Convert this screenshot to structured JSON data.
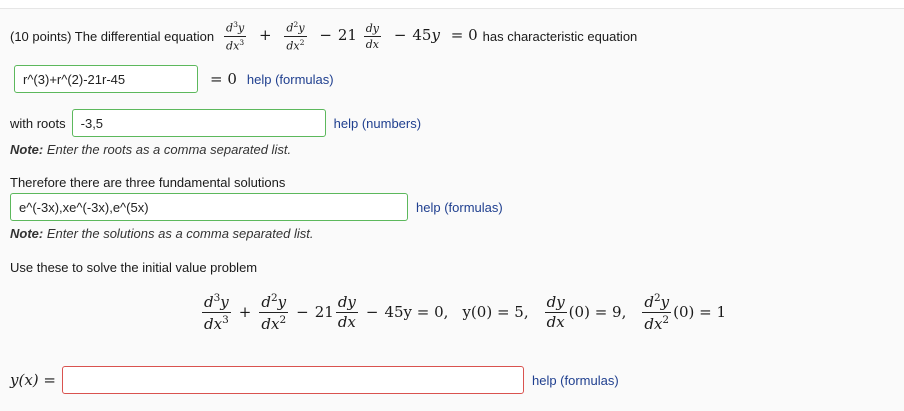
{
  "question": {
    "intro": "(10 points) The differential equation",
    "coef_21": "21",
    "coef_45": "45",
    "has_char": "has characteristic equation",
    "eq_zero": "= 0"
  },
  "char_eq": {
    "value": "r^(3)+r^(2)-21r-45",
    "help": "help (formulas)"
  },
  "roots": {
    "label": "with roots",
    "value": "-3,5",
    "help": "help (numbers)",
    "note_bold": "Note:",
    "note_text": " Enter the roots as a comma separated list."
  },
  "solutions": {
    "label": "Therefore there are three fundamental solutions",
    "value": "e^(-3x),xe^(-3x),e^(5x)",
    "help": "help (formulas)",
    "note_bold": "Note:",
    "note_text": " Enter the solutions as a comma separated list."
  },
  "ivp": {
    "label": "Use these to solve the initial value problem",
    "coef_21": "21",
    "rhs": "45y = 0,",
    "ic1": "y(0) = 5,",
    "ic2_val": "(0) = 9,",
    "ic3_val": "(0) = 1"
  },
  "answer": {
    "label": "y(x) =",
    "value": "",
    "help": "help (formulas)"
  }
}
